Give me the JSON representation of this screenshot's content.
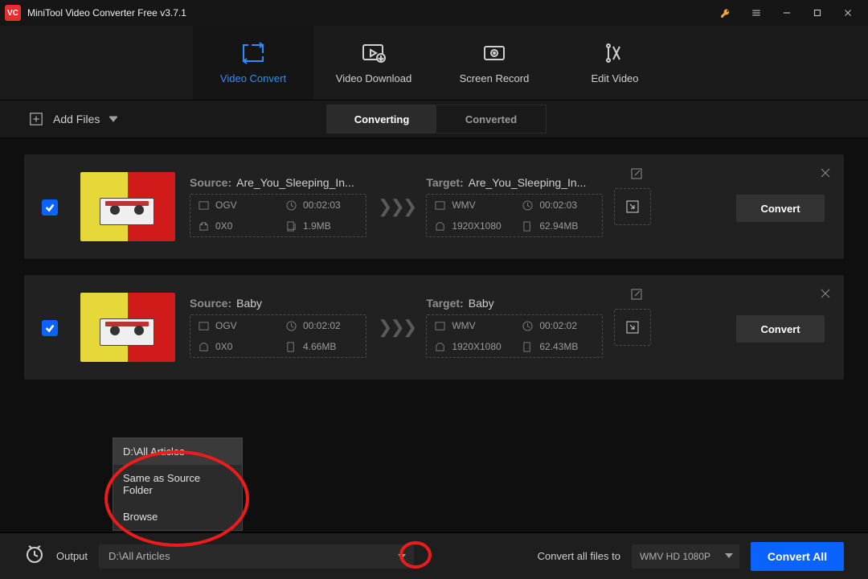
{
  "title": "MiniTool Video Converter Free v3.7.1",
  "nav": {
    "convert": "Video Convert",
    "download": "Video Download",
    "record": "Screen Record",
    "edit": "Edit Video"
  },
  "toolbar": {
    "add_files": "Add Files",
    "segments": {
      "converting": "Converting",
      "converted": "Converted"
    }
  },
  "labels": {
    "source": "Source:",
    "target": "Target:",
    "convert": "Convert",
    "output": "Output",
    "convert_all_files_to": "Convert all files to",
    "convert_all": "Convert All"
  },
  "items": [
    {
      "source_name": "Are_You_Sleeping_In...",
      "target_name": "Are_You_Sleeping_In...",
      "source": {
        "format": "OGV",
        "duration": "00:02:03",
        "resolution": "0X0",
        "size": "1.9MB"
      },
      "target": {
        "format": "WMV",
        "duration": "00:02:03",
        "resolution": "1920X1080",
        "size": "62.94MB"
      }
    },
    {
      "source_name": "Baby",
      "target_name": "Baby",
      "source": {
        "format": "OGV",
        "duration": "00:02:02",
        "resolution": "0X0",
        "size": "4.66MB"
      },
      "target": {
        "format": "WMV",
        "duration": "00:02:02",
        "resolution": "1920X1080",
        "size": "62.43MB"
      }
    }
  ],
  "output_path": "D:\\All Articles",
  "output_dropdown": {
    "opt1": "D:\\All Articles",
    "opt2": "Same as Source Folder",
    "opt3": "Browse"
  },
  "target_format": "WMV HD 1080P"
}
